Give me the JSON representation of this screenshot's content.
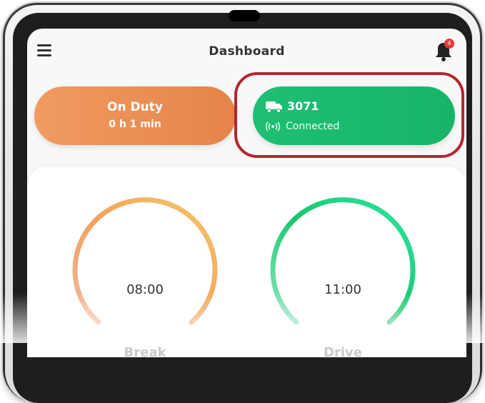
{
  "header": {
    "title": "Dashboard",
    "notification_count": "4"
  },
  "duty": {
    "status": "On Duty",
    "time": "0 h 1 min"
  },
  "truck": {
    "id": "3071",
    "connection": "Connected"
  },
  "gauges": [
    {
      "label": "Break",
      "value": "08:00",
      "colors": [
        "#f6c76a",
        "#e88550"
      ]
    },
    {
      "label": "Drive",
      "value": "11:00",
      "colors": [
        "#2fe6a5",
        "#18c66a"
      ]
    }
  ],
  "colors": {
    "duty": "#e8894e",
    "truck": "#1bb86c",
    "highlight": "#b3262d"
  }
}
